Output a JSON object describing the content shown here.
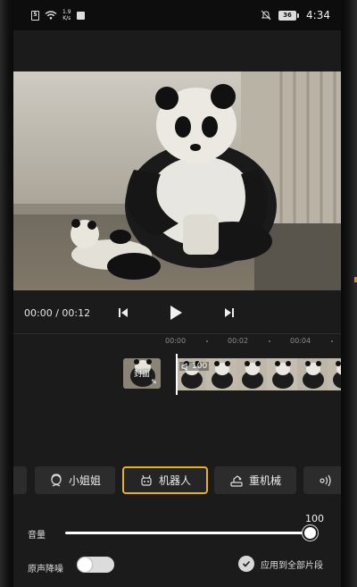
{
  "status_bar": {
    "net_speed_value": "1.9",
    "net_speed_unit": "K/s",
    "battery": "36",
    "time": "4:34"
  },
  "player": {
    "current_time": "00:00",
    "separator": " / ",
    "duration": "00:12"
  },
  "timeline": {
    "ruler": [
      "00:00",
      "00:02",
      "00:04"
    ],
    "cover_label": "封面",
    "clip_volume": "100"
  },
  "effects": {
    "items": [
      {
        "label": "小姐姐",
        "icon": "girl-face-icon"
      },
      {
        "label": "机器人",
        "icon": "robot-icon",
        "selected": true
      },
      {
        "label": "重机械",
        "icon": "machinery-icon"
      },
      {
        "label": "",
        "icon": "sound-wave-icon"
      }
    ]
  },
  "volume": {
    "label": "音量",
    "value": "100",
    "level_percent": 100
  },
  "denoise": {
    "label": "原声降噪",
    "enabled": false
  },
  "apply_all": {
    "label": "应用到全部片段",
    "checked": true
  },
  "colors": {
    "accent": "#e8b21a",
    "background": "#1b1b1b",
    "chip": "#2c2c2c"
  }
}
